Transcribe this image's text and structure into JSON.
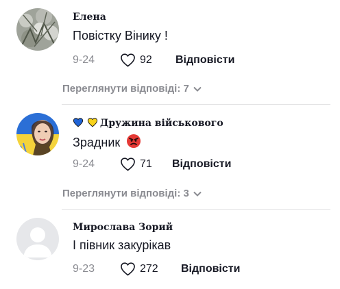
{
  "comments": [
    {
      "author": "Елена",
      "text": "Повістку Вінику !",
      "date": "9-24",
      "likes": "92",
      "reply_label": "Відповісти",
      "view_replies": "Переглянути відповіді: 7"
    },
    {
      "author": "Дружина військового",
      "author_prefix_icons": [
        "blue-heart-icon",
        "yellow-heart-icon"
      ],
      "text": "Зрадник",
      "text_emoji": "angry-face-icon",
      "date": "9-24",
      "likes": "71",
      "reply_label": "Відповісти",
      "view_replies": "Переглянути відповіді: 3"
    },
    {
      "author": "Мирослава Зорий",
      "text": "І півник закурікав",
      "date": "9-23",
      "likes": "272",
      "reply_label": "Відповісти"
    }
  ],
  "colors": {
    "text": "#161823",
    "muted": "#8a8b91",
    "blue_heart": "#1f63d6",
    "yellow_heart": "#f7d21a",
    "angry_red": "#e53935"
  }
}
